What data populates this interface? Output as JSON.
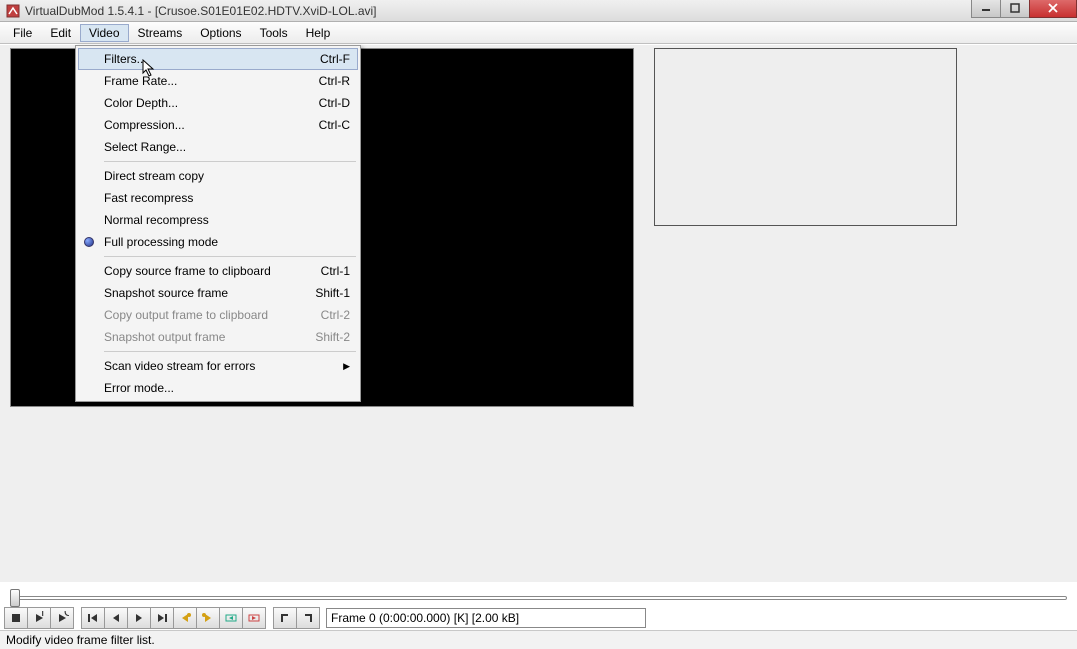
{
  "title": "VirtualDubMod 1.5.4.1 - [Crusoe.S01E01E02.HDTV.XviD-LOL.avi]",
  "menu": {
    "file": "File",
    "edit": "Edit",
    "video": "Video",
    "streams": "Streams",
    "options": "Options",
    "tools": "Tools",
    "help": "Help"
  },
  "dropdown": {
    "filters": "Filters...",
    "filters_sc": "Ctrl-F",
    "framerate": "Frame Rate...",
    "framerate_sc": "Ctrl-R",
    "colordepth": "Color Depth...",
    "colordepth_sc": "Ctrl-D",
    "compression": "Compression...",
    "compression_sc": "Ctrl-C",
    "selectrange": "Select Range...",
    "direct": "Direct stream copy",
    "fast": "Fast recompress",
    "normal": "Normal recompress",
    "full": "Full processing mode",
    "copy_src": "Copy source frame to clipboard",
    "copy_src_sc": "Ctrl-1",
    "snap_src": "Snapshot source frame",
    "snap_src_sc": "Shift-1",
    "copy_out": "Copy output frame to clipboard",
    "copy_out_sc": "Ctrl-2",
    "snap_out": "Snapshot output frame",
    "snap_out_sc": "Shift-2",
    "scan": "Scan video stream for errors",
    "errmode": "Error mode..."
  },
  "frame_info": "Frame 0 (0:00:00.000) [K] [2.00 kB]",
  "status": "Modify video frame filter list."
}
